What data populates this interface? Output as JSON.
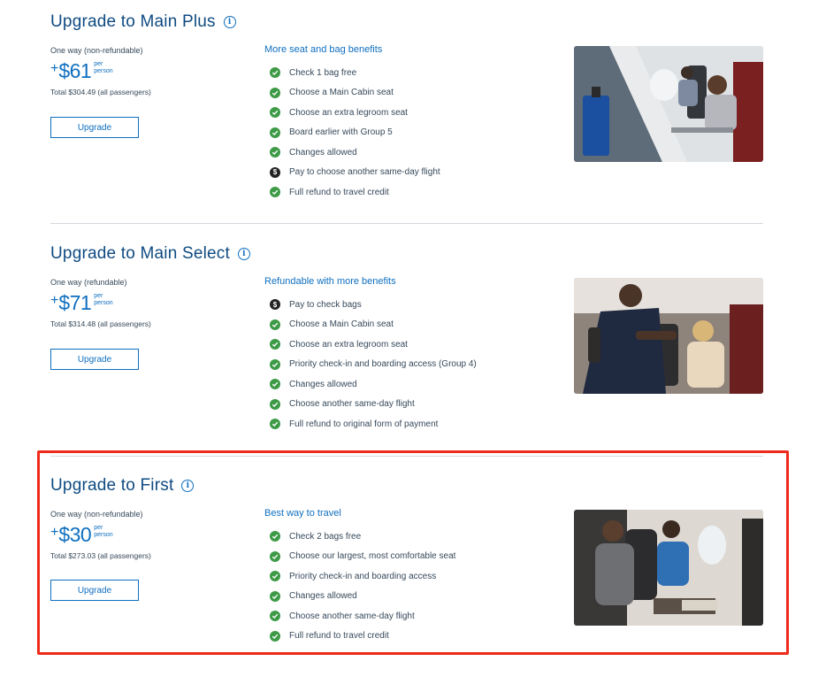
{
  "colors": {
    "accent": "#0f6fbf",
    "title": "#0f4b82",
    "check": "#3d9a46",
    "highlight": "#ef2a1b"
  },
  "info_icon_glyph": "i",
  "dollar_icon_glyph": "$",
  "sections": [
    {
      "title": "Upgrade to Main Plus",
      "fare_type": "One way (non-refundable)",
      "plus": "+",
      "amount": "$61",
      "per_1": "per",
      "per_2": "person",
      "total": "Total $304.49 (all passengers)",
      "button": "Upgrade",
      "benefits_heading": "More seat and bag benefits",
      "benefits": [
        {
          "icon": "check-icon",
          "text": "Check 1 bag free"
        },
        {
          "icon": "check-icon",
          "text": "Choose a Main Cabin seat"
        },
        {
          "icon": "check-icon",
          "text": "Choose an extra legroom seat"
        },
        {
          "icon": "check-icon",
          "text": "Board earlier with Group 5"
        },
        {
          "icon": "check-icon",
          "text": "Changes allowed"
        },
        {
          "icon": "dollar-icon",
          "text": "Pay to choose another same-day flight"
        },
        {
          "icon": "check-icon",
          "text": "Full refund to travel credit"
        }
      ]
    },
    {
      "title": "Upgrade to Main Select",
      "fare_type": "One way (refundable)",
      "plus": "+",
      "amount": "$71",
      "per_1": "per",
      "per_2": "person",
      "total": "Total $314.48 (all passengers)",
      "button": "Upgrade",
      "benefits_heading": "Refundable with more benefits",
      "benefits": [
        {
          "icon": "dollar-icon",
          "text": "Pay to check bags"
        },
        {
          "icon": "check-icon",
          "text": "Choose a Main Cabin seat"
        },
        {
          "icon": "check-icon",
          "text": "Choose an extra legroom seat"
        },
        {
          "icon": "check-icon",
          "text": "Priority check-in and boarding access (Group 4)"
        },
        {
          "icon": "check-icon",
          "text": "Changes allowed"
        },
        {
          "icon": "check-icon",
          "text": "Choose another same-day flight"
        },
        {
          "icon": "check-icon",
          "text": "Full refund to original form of payment"
        }
      ]
    },
    {
      "title": "Upgrade to First",
      "fare_type": "One way (non-refundable)",
      "plus": "+",
      "amount": "$30",
      "per_1": "per",
      "per_2": "person",
      "total": "Total $273.03 (all passengers)",
      "button": "Upgrade",
      "benefits_heading": "Best way to travel",
      "benefits": [
        {
          "icon": "check-icon",
          "text": "Check 2 bags free"
        },
        {
          "icon": "check-icon",
          "text": "Choose our largest, most comfortable seat"
        },
        {
          "icon": "check-icon",
          "text": "Priority check-in and boarding access"
        },
        {
          "icon": "check-icon",
          "text": "Changes allowed"
        },
        {
          "icon": "check-icon",
          "text": "Choose another same-day flight"
        },
        {
          "icon": "check-icon",
          "text": "Full refund to travel credit"
        }
      ]
    }
  ]
}
